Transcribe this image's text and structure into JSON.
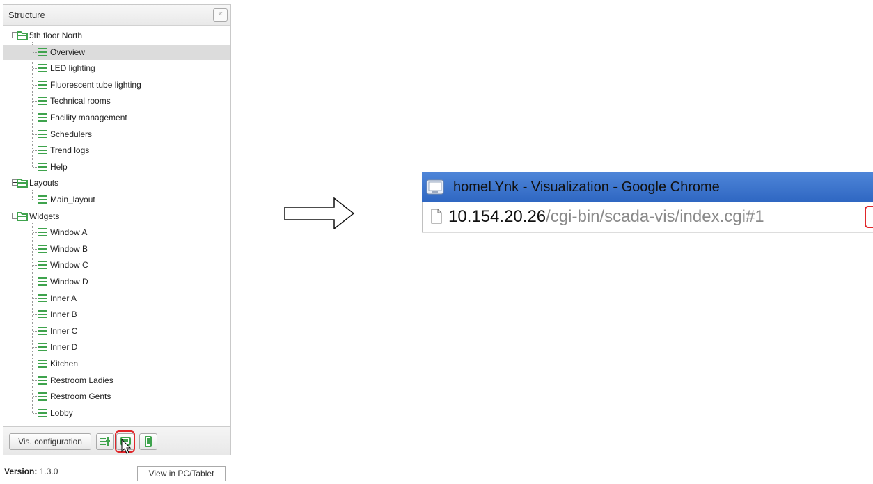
{
  "structure_panel": {
    "title": "Structure",
    "collapse_label": "«",
    "tree": [
      {
        "label": "5th floor North",
        "kind": "folder",
        "children": [
          {
            "label": "Overview",
            "selected": true
          },
          {
            "label": "LED lighting"
          },
          {
            "label": "Fluorescent tube lighting"
          },
          {
            "label": "Technical rooms"
          },
          {
            "label": "Facility management"
          },
          {
            "label": "Schedulers"
          },
          {
            "label": "Trend logs"
          },
          {
            "label": "Help"
          }
        ]
      },
      {
        "label": "Layouts",
        "kind": "folder",
        "children": [
          {
            "label": "Main_layout"
          }
        ]
      },
      {
        "label": "Widgets",
        "kind": "folder",
        "children": [
          {
            "label": "Window A"
          },
          {
            "label": "Window B"
          },
          {
            "label": "Window C"
          },
          {
            "label": "Window D"
          },
          {
            "label": "Inner A"
          },
          {
            "label": "Inner B"
          },
          {
            "label": "Inner C"
          },
          {
            "label": "Inner D"
          },
          {
            "label": "Kitchen"
          },
          {
            "label": "Restroom Ladies"
          },
          {
            "label": "Restroom Gents"
          },
          {
            "label": "Lobby"
          }
        ]
      }
    ],
    "footer": {
      "config_button": "Vis. configuration",
      "icons": [
        "structure-config-icon",
        "view-pc-tablet-icon",
        "view-touch-icon"
      ]
    }
  },
  "version": {
    "label": "Version:",
    "value": "1.3.0"
  },
  "tooltip": "View in PC/Tablet",
  "browser": {
    "title": "homeLYnk - Visualization - Google Chrome",
    "url_host": "10.154.20.26",
    "url_path": "/cgi-bin/scada-vis/index.cgi#1"
  },
  "colors": {
    "folder_green": "#3fa34d",
    "highlight_red": "#e0262a",
    "titlebar_blue": "#3a72cc",
    "selected_row": "#dcdcdc"
  }
}
